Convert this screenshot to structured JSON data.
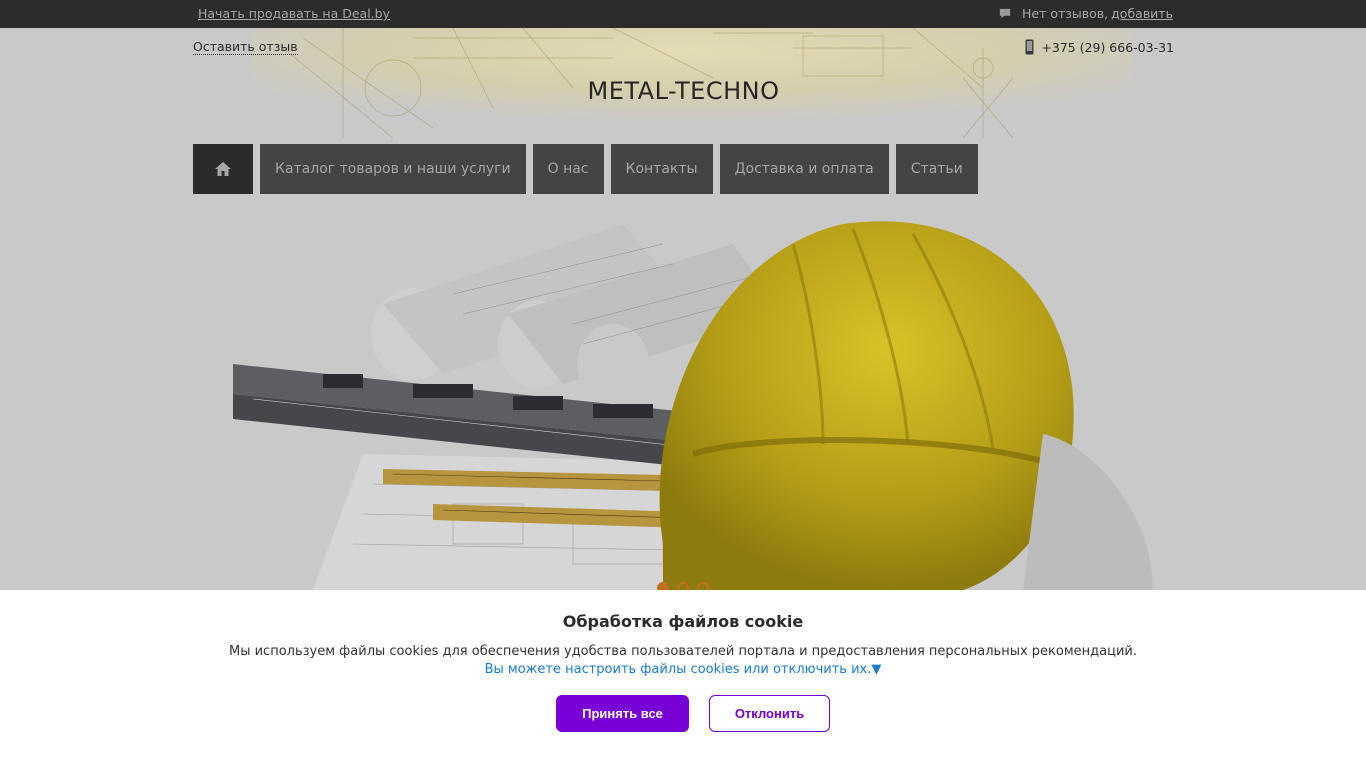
{
  "topbar": {
    "sell_link": "Начать продавать на Deal.by",
    "reviews_text": "Нет отзывов,",
    "reviews_add": "добавить"
  },
  "header": {
    "leave_review": "Оставить отзыв",
    "phone": "+375 (29) 666-03-31",
    "site_title": "METAL-TECHNO"
  },
  "nav": {
    "items": [
      {
        "label": "Каталог товаров и наши услуги"
      },
      {
        "label": "О нас"
      },
      {
        "label": "Контакты"
      },
      {
        "label": "Доставка и оплата"
      },
      {
        "label": "Статьи"
      }
    ]
  },
  "slider": {
    "active_slide": 1,
    "slide_count": 3
  },
  "cookie": {
    "title": "Обработка файлов cookie",
    "text": "Мы используем файлы cookies для обеспечения удобства пользователей портала и предоставления персональных рекомендаций.",
    "settings_link": "Вы можете настроить файлы cookies или отключить их.▼",
    "accept_label": "Принять все",
    "decline_label": "Отклонить"
  },
  "colors": {
    "topbar": "#2c2c2c",
    "nav_item": "#444444",
    "accent_purple": "#7800d6",
    "link_blue": "#1a7bd3",
    "slider_dot": "#c26f22"
  }
}
